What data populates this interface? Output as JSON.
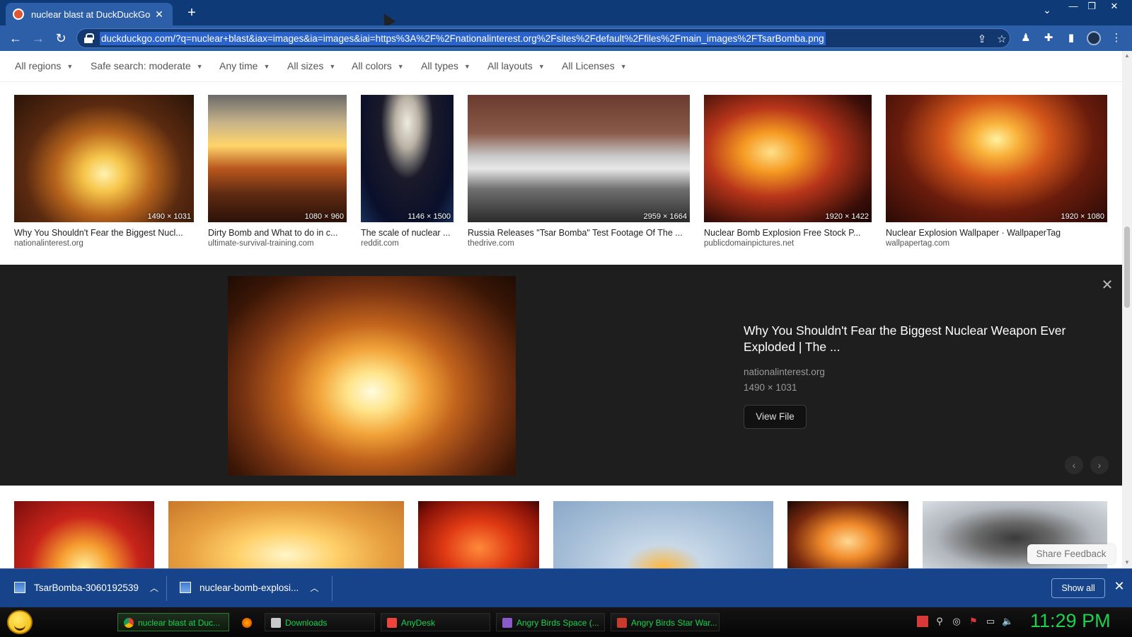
{
  "browser": {
    "tab_title": "nuclear blast at DuckDuckGo",
    "url": "duckduckgo.com/?q=nuclear+blast&iax=images&ia=images&iai=https%3A%2F%2Fnationalinterest.org%2Fsites%2Fdefault%2Ffiles%2Fmain_images%2FTsarBomba.png"
  },
  "filters": [
    "All regions",
    "Safe search: moderate",
    "Any time",
    "All sizes",
    "All colors",
    "All types",
    "All layouts",
    "All Licenses"
  ],
  "results_row1": [
    {
      "title": "Why You Shouldn't Fear the Biggest Nucl...",
      "source": "nationalinterest.org",
      "dims": "1490 × 1031"
    },
    {
      "title": "Dirty Bomb and What to do in c...",
      "source": "ultimate-survival-training.com",
      "dims": "1080 × 960"
    },
    {
      "title": "The scale of nuclear ...",
      "source": "reddit.com",
      "dims": "1146 × 1500"
    },
    {
      "title": "Russia Releases \"Tsar Bomba\" Test Footage Of The ...",
      "source": "thedrive.com",
      "dims": "2959 × 1664"
    },
    {
      "title": "Nuclear Bomb Explosion Free Stock P...",
      "source": "publicdomainpictures.net",
      "dims": "1920 × 1422"
    },
    {
      "title": "Nuclear Explosion Wallpaper · WallpaperTag",
      "source": "wallpapertag.com",
      "dims": "1920 × 1080"
    }
  ],
  "detail": {
    "title": "Why You Shouldn't Fear the Biggest Nuclear Weapon Ever Exploded | The ...",
    "source": "nationalinterest.org",
    "dims": "1490 × 1031",
    "view_file": "View File"
  },
  "share_feedback": "Share Feedback",
  "downloads": {
    "items": [
      "TsarBomba-3060192539",
      "nuclear-bomb-explosi..."
    ],
    "show_all": "Show all"
  },
  "taskbar": {
    "tasks": [
      "nuclear blast at Duc...",
      "",
      "Downloads",
      "AnyDesk",
      "Angry Birds Space (...",
      "Angry Birds Star War..."
    ],
    "clock": "11:29 PM"
  },
  "colors": {
    "titlebar": "#0f3a78",
    "toolbar": "#2d5fa8",
    "detail_bg": "#1e1e1e",
    "taskbar_text": "#1bd14f"
  }
}
